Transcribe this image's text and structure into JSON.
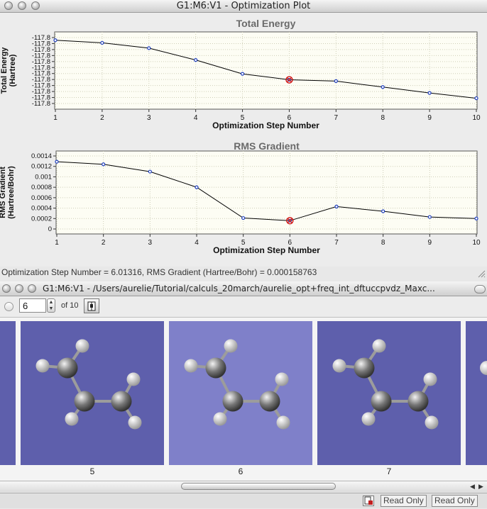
{
  "plot_window": {
    "title": "G1:M6:V1 - Optimization Plot",
    "status_text": "Optimization Step Number = 6.01316,  RMS Gradient (Hartree/Bohr) = 0.000158763"
  },
  "chart_data": [
    {
      "type": "line",
      "title": "Total Energy",
      "xlabel": "Optimization Step Number",
      "ylabel": "Total Energy (Hartree)",
      "ylabel_lines": [
        "Total Energy",
        "(Hartree)"
      ],
      "x": [
        1,
        2,
        3,
        4,
        5,
        6,
        7,
        8,
        9,
        10
      ],
      "x_ticks": [
        "1",
        "2",
        "3",
        "4",
        "5",
        "6",
        "7",
        "8",
        "9",
        "10"
      ],
      "y_tick_labels": [
        "-117.8",
        "-117.8",
        "-117.8",
        "-117.8",
        "-117.8",
        "-117.8",
        "-117.8",
        "-117.8",
        "-117.8",
        "-117.8",
        "-117.8",
        "-117.8"
      ],
      "values_norm": [
        0.96,
        0.92,
        0.84,
        0.66,
        0.45,
        0.36,
        0.34,
        0.25,
        0.16,
        0.08
      ],
      "selected_index": 5,
      "grid": true,
      "line_color": "#000000",
      "marker_color": "#1f3fbf",
      "selected_color": "#d01010"
    },
    {
      "type": "line",
      "title": "RMS Gradient",
      "xlabel": "Optimization Step Number",
      "ylabel": "RMS Gradient (Hartree/Bohr)",
      "ylabel_lines": [
        "RMS Gradient",
        "(Hartree/Bohr)"
      ],
      "x": [
        1,
        2,
        3,
        4,
        5,
        6,
        7,
        8,
        9,
        10
      ],
      "x_ticks": [
        "1",
        "2",
        "3",
        "4",
        "5",
        "6",
        "7",
        "8",
        "9",
        "10"
      ],
      "y_ticks": [
        0,
        0.0002,
        0.0004,
        0.0006,
        0.0008,
        0.001,
        0.0012,
        0.0014
      ],
      "y_tick_labels": [
        "0",
        "0.0002",
        "0.0004",
        "0.0006",
        "0.0008",
        "0.001",
        "0.0012",
        "0.0014"
      ],
      "ylim": [
        0,
        0.0014
      ],
      "values": [
        0.00129,
        0.00124,
        0.0011,
        0.0008,
        0.00021,
        0.000159,
        0.00043,
        0.00034,
        0.00023,
        0.0002
      ],
      "selected_index": 5,
      "grid": true,
      "line_color": "#000000",
      "marker_color": "#1f3fbf",
      "selected_color": "#d01010"
    }
  ],
  "molecule_window": {
    "title": "G1:M6:V1 - /Users/aurelie/Tutorial/calculs_20march/aurelie_opt+freq_int_dftuccpvdz_Maxc...",
    "step_value": "6",
    "of_label": "of 10",
    "stepper_icon": "up-down-arrows-icon",
    "book_icon": "book-icon",
    "frames": [
      {
        "label": "5",
        "selected": false
      },
      {
        "label": "6",
        "selected": true
      },
      {
        "label": "7",
        "selected": false
      }
    ],
    "frame_color": "#5e5fac",
    "selected_frame_color": "#7f80c9",
    "status": {
      "read_only_1": "Read Only",
      "read_only_2": "Read Only"
    }
  }
}
